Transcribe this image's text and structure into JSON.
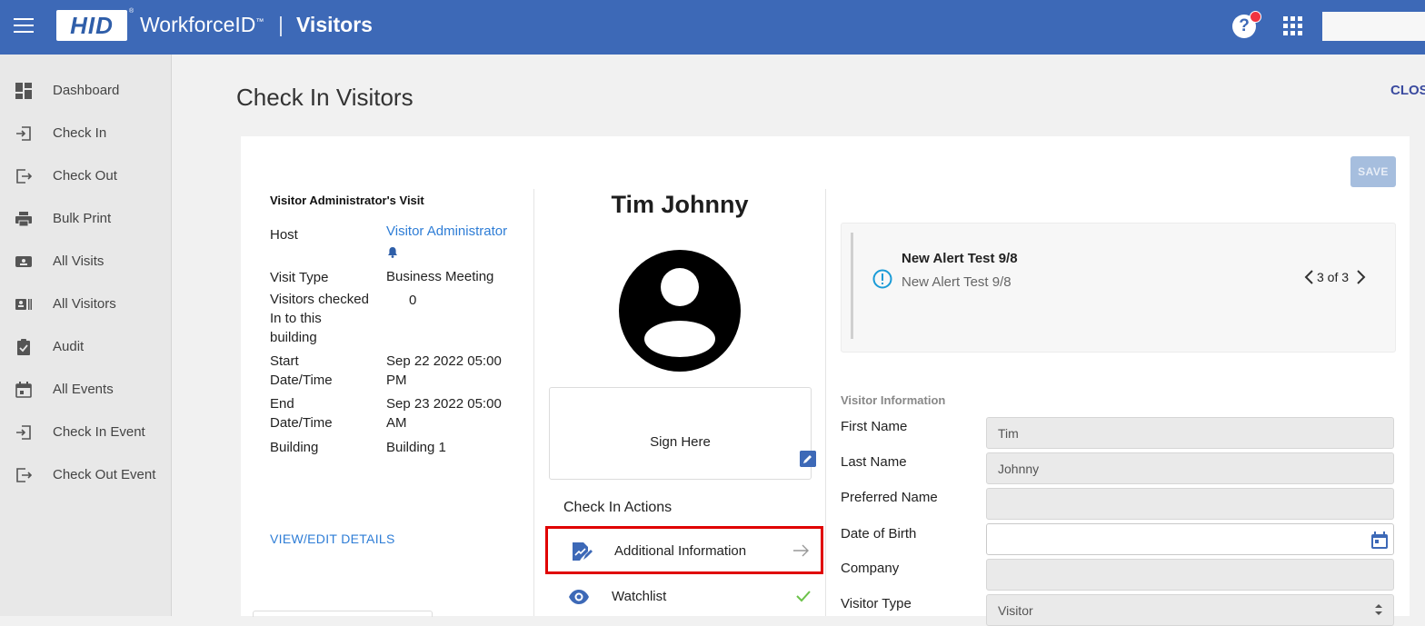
{
  "header": {
    "brand": "HID",
    "product": "WorkforceID",
    "product_tm": "™",
    "separator": "|",
    "module": "Visitors",
    "help_icon": "?"
  },
  "sidebar": {
    "items": [
      {
        "label": "Dashboard",
        "icon": "dashboard-icon"
      },
      {
        "label": "Check In",
        "icon": "login-icon"
      },
      {
        "label": "Check Out",
        "icon": "logout-icon"
      },
      {
        "label": "Bulk Print",
        "icon": "printer-icon"
      },
      {
        "label": "All Visits",
        "icon": "ticket-icon"
      },
      {
        "label": "All Visitors",
        "icon": "badge-icon"
      },
      {
        "label": "Audit",
        "icon": "clipboard-check-icon"
      },
      {
        "label": "All Events",
        "icon": "calendar-icon"
      },
      {
        "label": "Check In Event",
        "icon": "login-icon"
      },
      {
        "label": "Check Out Event",
        "icon": "logout-icon"
      }
    ]
  },
  "page": {
    "title": "Check In Visitors",
    "close_label": "CLOS",
    "save_label": "SAVE"
  },
  "visit": {
    "title": "Visitor Administrator's Visit",
    "host_label": "Host",
    "host_value": "Visitor Administrator",
    "visit_type_label": "Visit Type",
    "visit_type_value": "Business Meeting",
    "visitors_checked_label": "Visitors checked In to this building",
    "visitors_checked_value": "0",
    "start_label": "Start Date/Time",
    "start_value": "Sep 22 2022 05:00 PM",
    "end_label": "End Date/Time",
    "end_value": "Sep 23 2022 05:00 AM",
    "building_label": "Building",
    "building_value": "Building 1",
    "view_edit_label": "VIEW/EDIT DETAILS"
  },
  "visitor": {
    "name": "Tim Johnny",
    "sign_label": "Sign Here"
  },
  "actions": {
    "title": "Check In Actions",
    "items": [
      {
        "label": "Additional Information",
        "icon": "document-edit-icon",
        "status": "arrow-right-icon",
        "highlighted": true
      },
      {
        "label": "Watchlist",
        "icon": "eye-icon",
        "status": "check-icon",
        "highlighted": false
      }
    ]
  },
  "alert": {
    "title": "New Alert Test 9/8",
    "subtitle": "New Alert Test 9/8",
    "pager": "3 of 3",
    "current": 3,
    "total": 3
  },
  "form": {
    "section_title": "Visitor Information",
    "first_name_label": "First Name",
    "first_name_value": "Tim",
    "last_name_label": "Last Name",
    "last_name_value": "Johnny",
    "preferred_name_label": "Preferred Name",
    "preferred_name_value": "",
    "dob_label": "Date of Birth",
    "dob_value": "",
    "company_label": "Company",
    "company_value": "",
    "visitor_type_label": "Visitor Type",
    "visitor_type_value": "Visitor"
  },
  "colors": {
    "header_bg": "#3d69b7",
    "link": "#2e7dd6",
    "highlight_border": "#e00000",
    "notification": "#ef3340",
    "check": "#6cc24a",
    "alert_icon": "#1a9bd7"
  }
}
